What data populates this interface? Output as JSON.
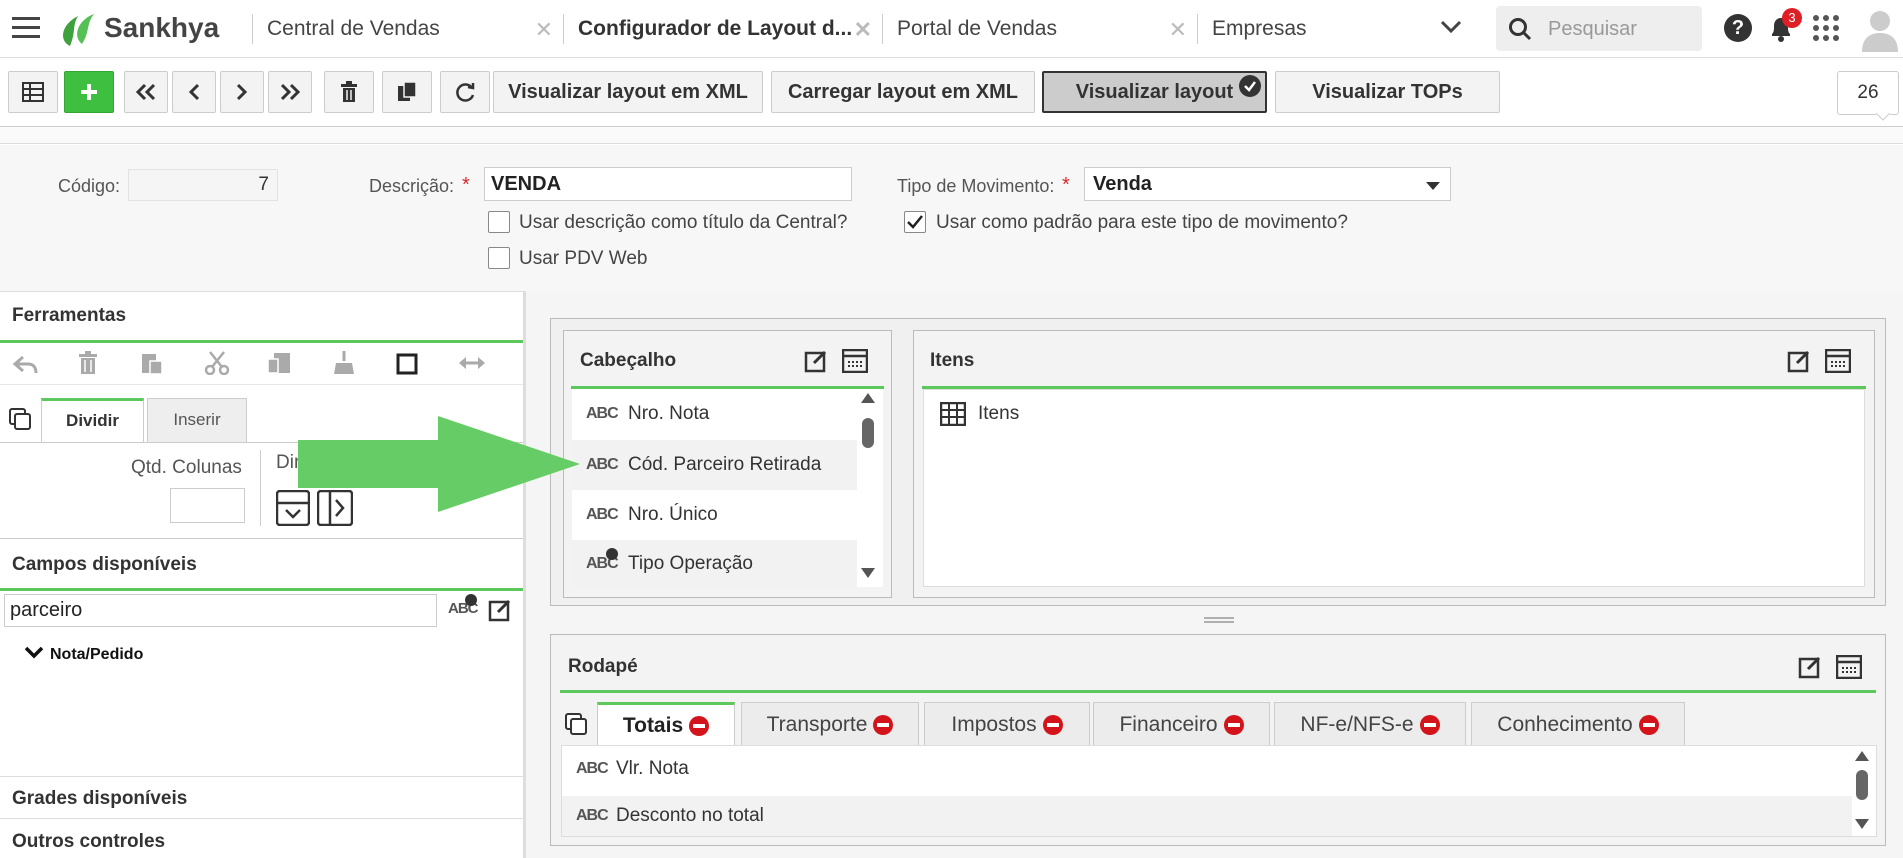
{
  "header": {
    "brand": "Sankhya",
    "tabs": [
      {
        "label": "Central de Vendas"
      },
      {
        "label": "Configurador de Layout d..."
      },
      {
        "label": "Portal de Vendas"
      },
      {
        "label": "Empresas"
      }
    ],
    "search_placeholder": "Pesquisar",
    "notification_count": "3"
  },
  "toolbar": {
    "btn_xml_view": "Visualizar layout em XML",
    "btn_xml_load": "Carregar layout em XML",
    "btn_layout_view": "Visualizar layout",
    "btn_tops": "Visualizar TOPs",
    "counter": "26"
  },
  "form": {
    "codigo_label": "Código:",
    "codigo_value": "7",
    "descricao_label": "Descrição:",
    "descricao_value": "VENDA",
    "tipo_label": "Tipo de Movimento:",
    "tipo_value": "Venda",
    "required_mark": "*",
    "chk_titulo": "Usar descrição como título da Central?",
    "chk_padrao": "Usar como padrão para este tipo de movimento?",
    "chk_pdv": "Usar PDV Web",
    "chk_titulo_checked": false,
    "chk_padrao_checked": true,
    "chk_pdv_checked": false
  },
  "left": {
    "ferramentas": "Ferramentas",
    "tab_dividir": "Dividir",
    "tab_inserir": "Inserir",
    "qtd_colunas": "Qtd. Colunas",
    "dir_label": "Dir",
    "campos": "Campos disponíveis",
    "search_value": "parceiro",
    "tree_node": "Nota/Pedido",
    "grades": "Grades disponíveis",
    "outros": "Outros controles"
  },
  "layout": {
    "cabecalho": {
      "title": "Cabeçalho",
      "items": [
        {
          "icon": "ABC",
          "label": "Nro. Nota"
        },
        {
          "icon": "ABC",
          "label": "Cód. Parceiro Retirada"
        },
        {
          "icon": "ABC",
          "label": "Nro. Único"
        },
        {
          "icon": "ABC",
          "label": "Tipo Operação"
        }
      ]
    },
    "itens": {
      "title": "Itens",
      "item": "Itens"
    },
    "rodape": {
      "title": "Rodapé",
      "tabs": [
        {
          "label": "Totais"
        },
        {
          "label": "Transporte"
        },
        {
          "label": "Impostos"
        },
        {
          "label": "Financeiro"
        },
        {
          "label": "NF-e/NFS-e"
        },
        {
          "label": "Conhecimento"
        }
      ],
      "items": [
        {
          "icon": "ABC",
          "label": "Vlr. Nota"
        },
        {
          "icon": "ABC",
          "label": "Desconto no total"
        }
      ]
    }
  },
  "colors": {
    "accent_green": "#5cc85c",
    "brand_green": "#3da13d",
    "arrow_green": "#66cc66",
    "remove_red": "#d4141b"
  }
}
